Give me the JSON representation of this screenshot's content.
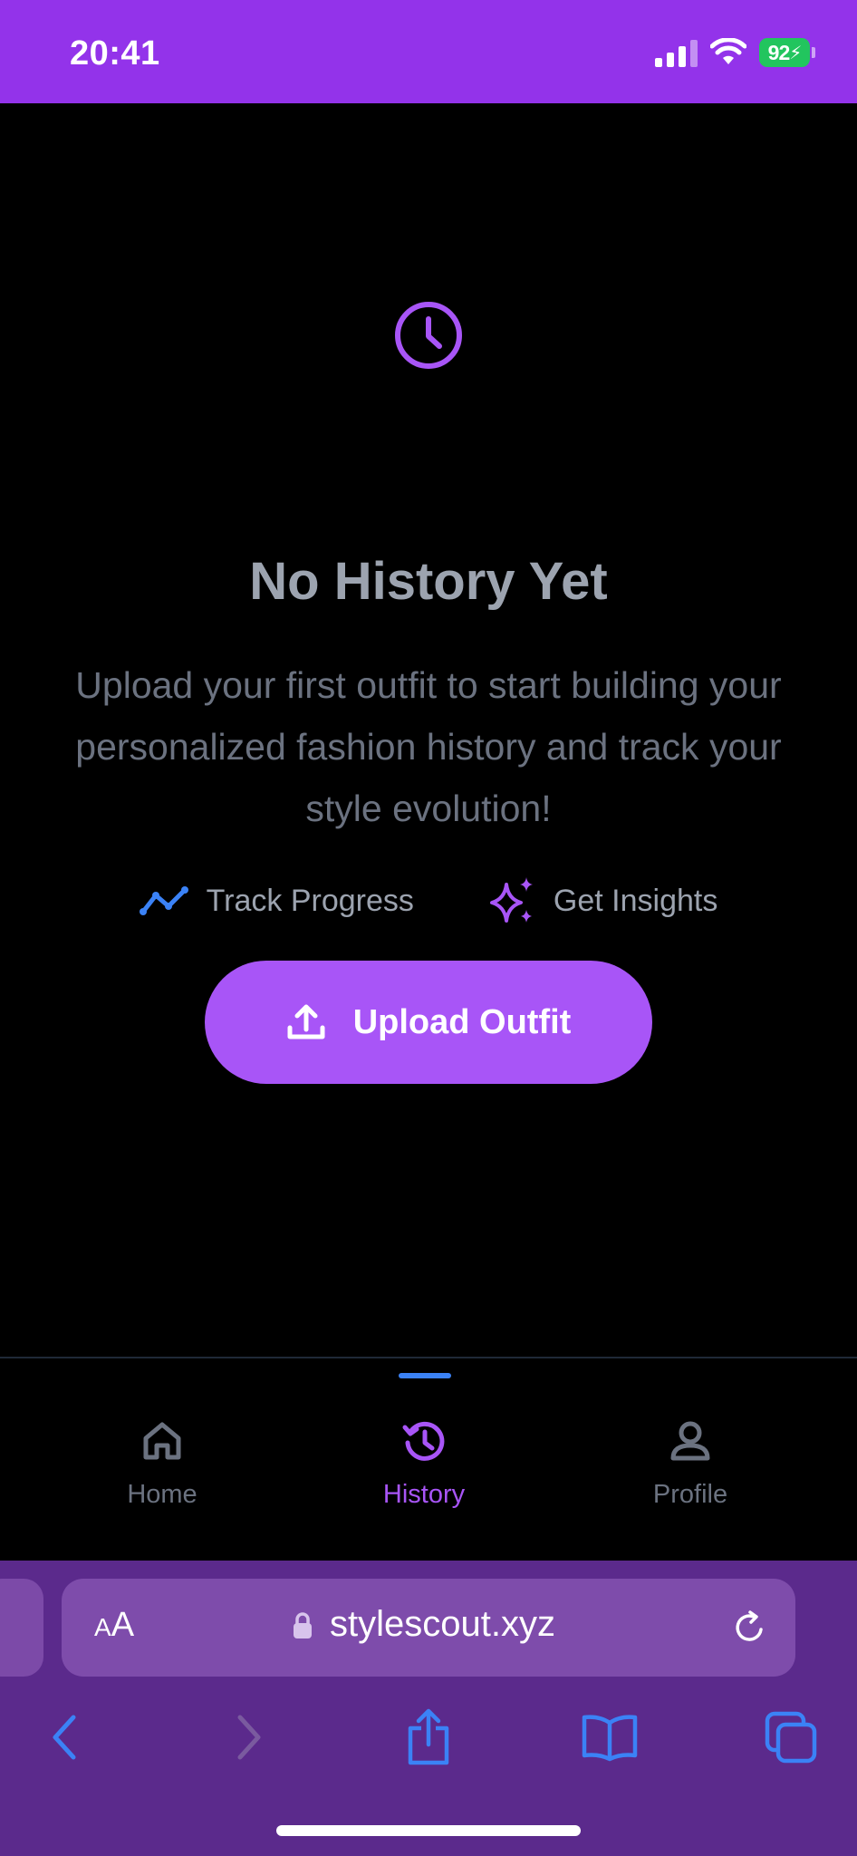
{
  "status_bar": {
    "time": "20:41",
    "battery": "92"
  },
  "empty_state": {
    "title": "No History Yet",
    "description": "Upload your first outfit to start building your personalized fashion history and track your style evolution!",
    "features": [
      {
        "icon": "trend-line-icon",
        "label": "Track Progress"
      },
      {
        "icon": "sparkles-icon",
        "label": "Get Insights"
      }
    ],
    "upload_button": {
      "icon": "upload-icon",
      "label": "Upload Outfit"
    }
  },
  "tab_bar": {
    "active": "History",
    "tabs": [
      {
        "icon": "home-icon",
        "label": "Home"
      },
      {
        "icon": "history-icon",
        "label": "History"
      },
      {
        "icon": "profile-icon",
        "label": "Profile"
      }
    ]
  },
  "browser": {
    "text_size_label_small": "A",
    "text_size_label_large": "A",
    "url": "stylescout.xyz"
  },
  "colors": {
    "status_bar": "#9333ea",
    "accent": "#a855f7",
    "active_indicator": "#3b82f6",
    "browser_bar": "#5b2a8c",
    "battery": "#22c55e"
  }
}
